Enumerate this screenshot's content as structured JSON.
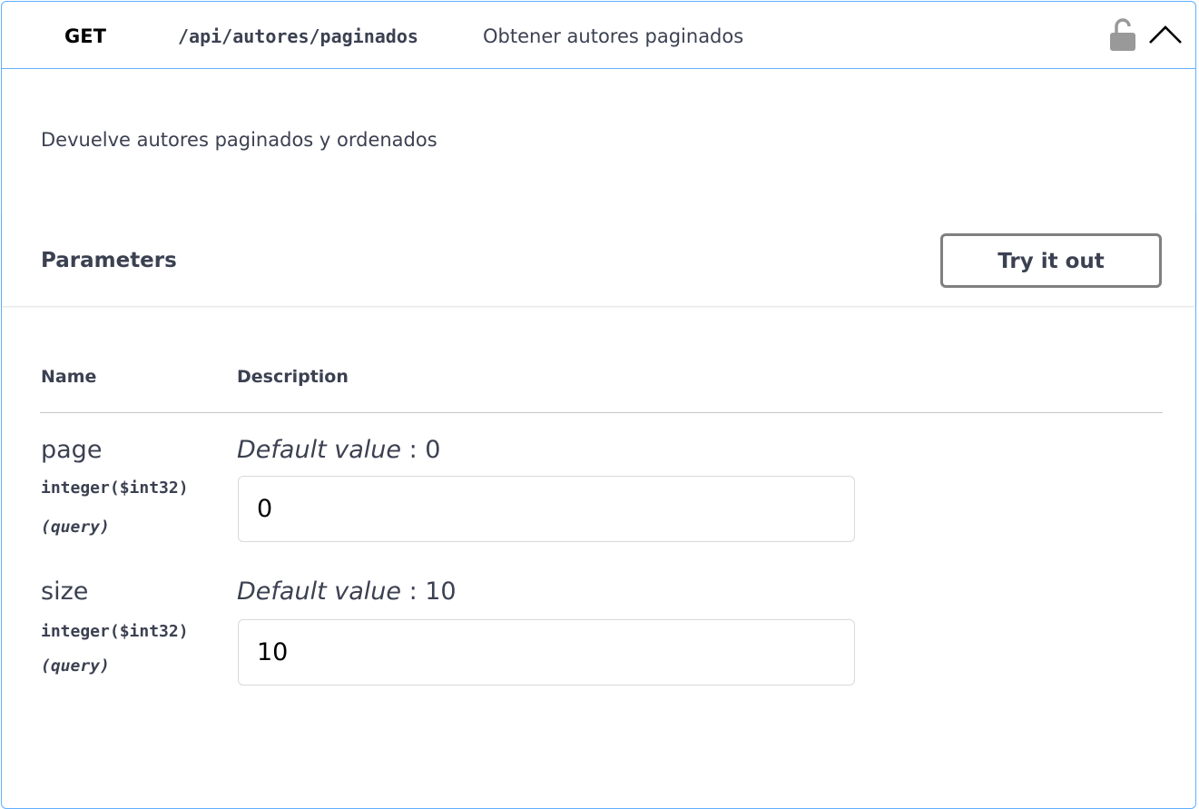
{
  "operation": {
    "method": "GET",
    "path": "/api/autores/paginados",
    "summary": "Obtener autores paginados",
    "description": "Devuelve autores paginados y ordenados"
  },
  "parameters_section": {
    "title": "Parameters",
    "try_button": "Try it out",
    "columns": {
      "name": "Name",
      "description": "Description"
    },
    "default_label": "Default value",
    "default_sep": " : "
  },
  "params": [
    {
      "name": "page",
      "type": "integer($int32)",
      "in": "(query)",
      "default": "0",
      "value": "0"
    },
    {
      "name": "size",
      "type": "integer($int32)",
      "in": "(query)",
      "default": "10",
      "value": "10"
    }
  ],
  "icons": {
    "lock": "unlocked-padlock-icon",
    "toggle": "chevron-up-icon"
  },
  "colors": {
    "accent": "#61affe",
    "text": "#3b4151"
  }
}
